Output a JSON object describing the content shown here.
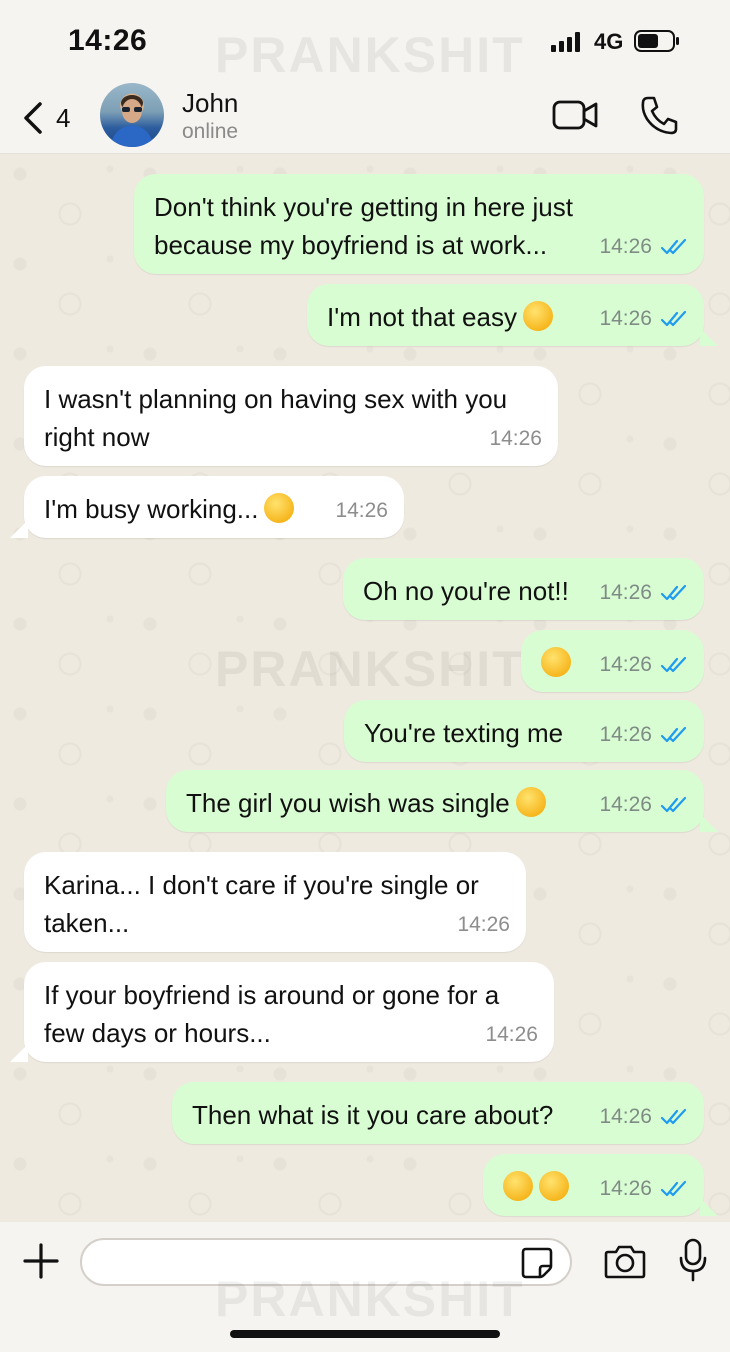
{
  "status_bar": {
    "time": "14:26",
    "network": "4G",
    "watermark": "PRANKSHIT"
  },
  "header": {
    "back_count": "4",
    "contact_name": "John",
    "contact_status": "online"
  },
  "messages": [
    {
      "dir": "out",
      "lines": [
        "Don't think you're getting in here just",
        "because my boyfriend is at work..."
      ],
      "time": "14:26",
      "emoji": ""
    },
    {
      "dir": "out",
      "text": "I'm not that easy",
      "time": "14:26",
      "emoji": "😝"
    },
    {
      "dir": "in",
      "lines": [
        "I wasn't planning on having sex with you",
        "right now"
      ],
      "time": "14:26"
    },
    {
      "dir": "in",
      "text": "I'm busy working...",
      "time": "14:26",
      "emoji": "😝"
    },
    {
      "dir": "out",
      "text": "Oh no you're not!!",
      "time": "14:26"
    },
    {
      "dir": "out",
      "text": "",
      "time": "14:26",
      "emoji": "🤭"
    },
    {
      "dir": "out",
      "text": "You're texting me",
      "time": "14:26"
    },
    {
      "dir": "out",
      "text": "The girl you wish was single",
      "time": "14:26",
      "emoji": "😊"
    },
    {
      "dir": "in",
      "lines": [
        "Karina... I don't care if you're single or",
        "taken..."
      ],
      "time": "14:26"
    },
    {
      "dir": "in",
      "lines": [
        "If your boyfriend is around or gone for a",
        "few days or hours..."
      ],
      "time": "14:26"
    },
    {
      "dir": "out",
      "text": "Then what is it you care about?",
      "time": "14:26"
    },
    {
      "dir": "out",
      "text": "",
      "time": "14:26",
      "emoji": "😳 😳"
    }
  ],
  "input": {
    "placeholder": "",
    "value": ""
  },
  "colors": {
    "outgoing": "#d9fdd3",
    "incoming": "#ffffff",
    "tick": "#1e9bf0"
  },
  "icons": [
    "back-chevron-icon",
    "video-camera-icon",
    "phone-icon",
    "plus-icon",
    "sticker-icon",
    "camera-icon",
    "microphone-icon",
    "double-check-icon"
  ]
}
